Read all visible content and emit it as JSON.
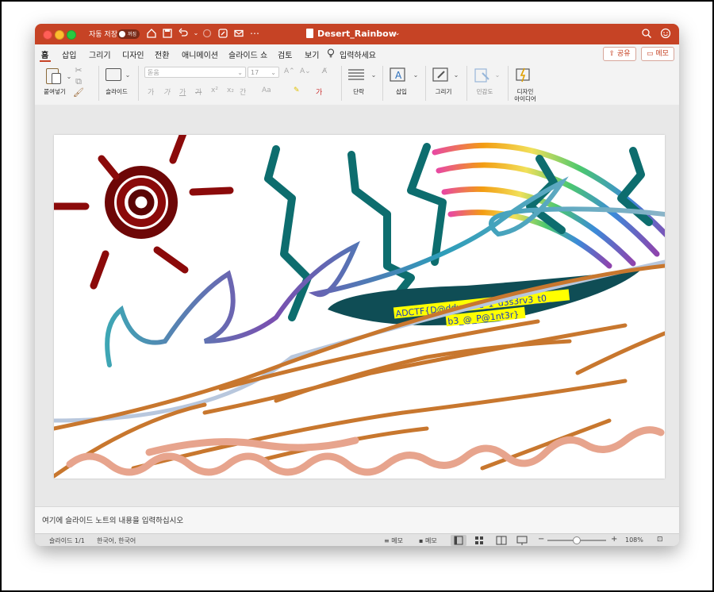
{
  "window": {
    "autosave_label": "자동 저장",
    "autosave_state": "꺼짐",
    "title": "Desert_Rainbow",
    "accent": "#c64325"
  },
  "tabs": [
    "홈",
    "삽입",
    "그리기",
    "디자인",
    "전환",
    "애니메이션",
    "슬라이드 쇼",
    "검토",
    "보기"
  ],
  "search_placeholder": "입력하세요",
  "share_label": "공유",
  "comment_label": "메모",
  "ribbon": {
    "paste_label": "붙여넣기",
    "slide_label": "슬라이드",
    "font_name": "돋움",
    "font_size": "17",
    "paragraph_label": "단락",
    "insert_label": "삽입",
    "draw_label": "그리기",
    "sensitivity_label": "민감도",
    "designer_label_1": "디자인",
    "designer_label_2": "아이디어"
  },
  "slide": {
    "flag_line1": "ADCTF{D@ddy_said_1_d3s3rv3_t0_",
    "flag_line2": "b3_@_P@1nt3r}",
    "highlight": "#ffff00"
  },
  "notes_placeholder": "여기에 슬라이드 노트의 내용을 입력하십시오",
  "status": {
    "slide_indicator": "슬라이드 1/1",
    "language": "한국어, 한국어",
    "notes_button": "메모",
    "comments_button": "메모",
    "zoom": "108%"
  }
}
